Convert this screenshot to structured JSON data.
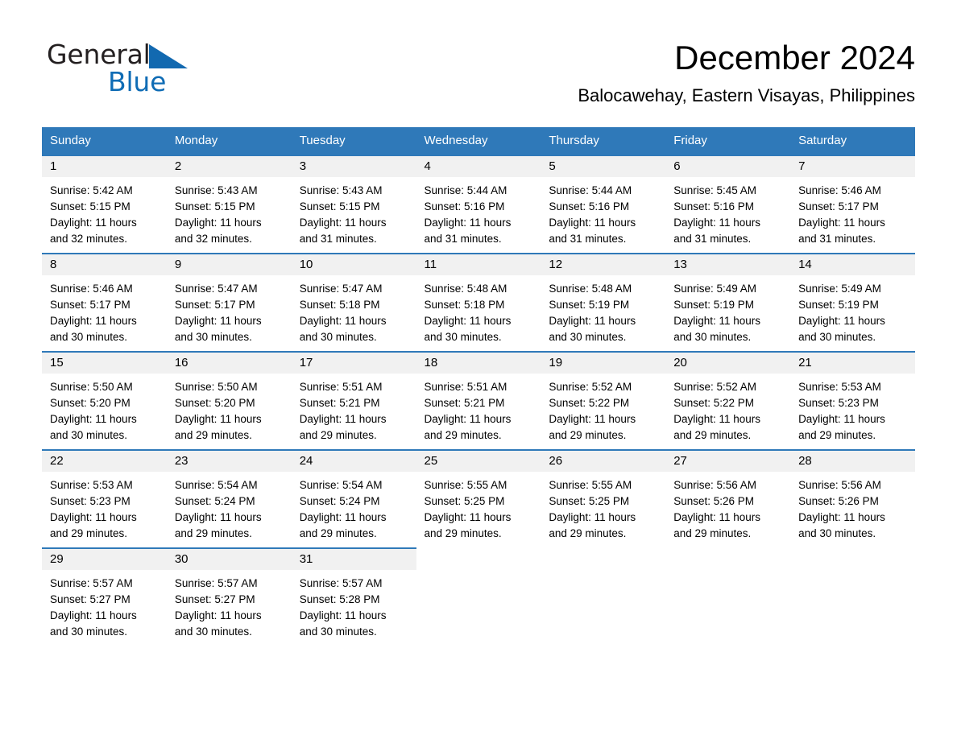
{
  "brand": {
    "name_part1": "General",
    "name_part2": "Blue",
    "triangle_color": "#1269b0",
    "text_color": "#231f20"
  },
  "header": {
    "title": "December 2024",
    "subtitle": "Balocawehay, Eastern Visayas, Philippines"
  },
  "colors": {
    "header_blue": "#2f79b9",
    "row_divider_blue": "#2f79b9",
    "daynum_band": "#f1f1f1",
    "background": "#ffffff",
    "text": "#000000"
  },
  "weekday_headers": [
    "Sunday",
    "Monday",
    "Tuesday",
    "Wednesday",
    "Thursday",
    "Friday",
    "Saturday"
  ],
  "labels": {
    "sunrise_prefix": "Sunrise:",
    "sunset_prefix": "Sunset:",
    "daylight_prefix": "Daylight:"
  },
  "weeks": [
    [
      {
        "day": "1",
        "sunrise": "Sunrise: 5:42 AM",
        "sunset": "Sunset: 5:15 PM",
        "daylight_line1": "Daylight: 11 hours",
        "daylight_line2": "and 32 minutes."
      },
      {
        "day": "2",
        "sunrise": "Sunrise: 5:43 AM",
        "sunset": "Sunset: 5:15 PM",
        "daylight_line1": "Daylight: 11 hours",
        "daylight_line2": "and 32 minutes."
      },
      {
        "day": "3",
        "sunrise": "Sunrise: 5:43 AM",
        "sunset": "Sunset: 5:15 PM",
        "daylight_line1": "Daylight: 11 hours",
        "daylight_line2": "and 31 minutes."
      },
      {
        "day": "4",
        "sunrise": "Sunrise: 5:44 AM",
        "sunset": "Sunset: 5:16 PM",
        "daylight_line1": "Daylight: 11 hours",
        "daylight_line2": "and 31 minutes."
      },
      {
        "day": "5",
        "sunrise": "Sunrise: 5:44 AM",
        "sunset": "Sunset: 5:16 PM",
        "daylight_line1": "Daylight: 11 hours",
        "daylight_line2": "and 31 minutes."
      },
      {
        "day": "6",
        "sunrise": "Sunrise: 5:45 AM",
        "sunset": "Sunset: 5:16 PM",
        "daylight_line1": "Daylight: 11 hours",
        "daylight_line2": "and 31 minutes."
      },
      {
        "day": "7",
        "sunrise": "Sunrise: 5:46 AM",
        "sunset": "Sunset: 5:17 PM",
        "daylight_line1": "Daylight: 11 hours",
        "daylight_line2": "and 31 minutes."
      }
    ],
    [
      {
        "day": "8",
        "sunrise": "Sunrise: 5:46 AM",
        "sunset": "Sunset: 5:17 PM",
        "daylight_line1": "Daylight: 11 hours",
        "daylight_line2": "and 30 minutes."
      },
      {
        "day": "9",
        "sunrise": "Sunrise: 5:47 AM",
        "sunset": "Sunset: 5:17 PM",
        "daylight_line1": "Daylight: 11 hours",
        "daylight_line2": "and 30 minutes."
      },
      {
        "day": "10",
        "sunrise": "Sunrise: 5:47 AM",
        "sunset": "Sunset: 5:18 PM",
        "daylight_line1": "Daylight: 11 hours",
        "daylight_line2": "and 30 minutes."
      },
      {
        "day": "11",
        "sunrise": "Sunrise: 5:48 AM",
        "sunset": "Sunset: 5:18 PM",
        "daylight_line1": "Daylight: 11 hours",
        "daylight_line2": "and 30 minutes."
      },
      {
        "day": "12",
        "sunrise": "Sunrise: 5:48 AM",
        "sunset": "Sunset: 5:19 PM",
        "daylight_line1": "Daylight: 11 hours",
        "daylight_line2": "and 30 minutes."
      },
      {
        "day": "13",
        "sunrise": "Sunrise: 5:49 AM",
        "sunset": "Sunset: 5:19 PM",
        "daylight_line1": "Daylight: 11 hours",
        "daylight_line2": "and 30 minutes."
      },
      {
        "day": "14",
        "sunrise": "Sunrise: 5:49 AM",
        "sunset": "Sunset: 5:19 PM",
        "daylight_line1": "Daylight: 11 hours",
        "daylight_line2": "and 30 minutes."
      }
    ],
    [
      {
        "day": "15",
        "sunrise": "Sunrise: 5:50 AM",
        "sunset": "Sunset: 5:20 PM",
        "daylight_line1": "Daylight: 11 hours",
        "daylight_line2": "and 30 minutes."
      },
      {
        "day": "16",
        "sunrise": "Sunrise: 5:50 AM",
        "sunset": "Sunset: 5:20 PM",
        "daylight_line1": "Daylight: 11 hours",
        "daylight_line2": "and 29 minutes."
      },
      {
        "day": "17",
        "sunrise": "Sunrise: 5:51 AM",
        "sunset": "Sunset: 5:21 PM",
        "daylight_line1": "Daylight: 11 hours",
        "daylight_line2": "and 29 minutes."
      },
      {
        "day": "18",
        "sunrise": "Sunrise: 5:51 AM",
        "sunset": "Sunset: 5:21 PM",
        "daylight_line1": "Daylight: 11 hours",
        "daylight_line2": "and 29 minutes."
      },
      {
        "day": "19",
        "sunrise": "Sunrise: 5:52 AM",
        "sunset": "Sunset: 5:22 PM",
        "daylight_line1": "Daylight: 11 hours",
        "daylight_line2": "and 29 minutes."
      },
      {
        "day": "20",
        "sunrise": "Sunrise: 5:52 AM",
        "sunset": "Sunset: 5:22 PM",
        "daylight_line1": "Daylight: 11 hours",
        "daylight_line2": "and 29 minutes."
      },
      {
        "day": "21",
        "sunrise": "Sunrise: 5:53 AM",
        "sunset": "Sunset: 5:23 PM",
        "daylight_line1": "Daylight: 11 hours",
        "daylight_line2": "and 29 minutes."
      }
    ],
    [
      {
        "day": "22",
        "sunrise": "Sunrise: 5:53 AM",
        "sunset": "Sunset: 5:23 PM",
        "daylight_line1": "Daylight: 11 hours",
        "daylight_line2": "and 29 minutes."
      },
      {
        "day": "23",
        "sunrise": "Sunrise: 5:54 AM",
        "sunset": "Sunset: 5:24 PM",
        "daylight_line1": "Daylight: 11 hours",
        "daylight_line2": "and 29 minutes."
      },
      {
        "day": "24",
        "sunrise": "Sunrise: 5:54 AM",
        "sunset": "Sunset: 5:24 PM",
        "daylight_line1": "Daylight: 11 hours",
        "daylight_line2": "and 29 minutes."
      },
      {
        "day": "25",
        "sunrise": "Sunrise: 5:55 AM",
        "sunset": "Sunset: 5:25 PM",
        "daylight_line1": "Daylight: 11 hours",
        "daylight_line2": "and 29 minutes."
      },
      {
        "day": "26",
        "sunrise": "Sunrise: 5:55 AM",
        "sunset": "Sunset: 5:25 PM",
        "daylight_line1": "Daylight: 11 hours",
        "daylight_line2": "and 29 minutes."
      },
      {
        "day": "27",
        "sunrise": "Sunrise: 5:56 AM",
        "sunset": "Sunset: 5:26 PM",
        "daylight_line1": "Daylight: 11 hours",
        "daylight_line2": "and 29 minutes."
      },
      {
        "day": "28",
        "sunrise": "Sunrise: 5:56 AM",
        "sunset": "Sunset: 5:26 PM",
        "daylight_line1": "Daylight: 11 hours",
        "daylight_line2": "and 30 minutes."
      }
    ],
    [
      {
        "day": "29",
        "sunrise": "Sunrise: 5:57 AM",
        "sunset": "Sunset: 5:27 PM",
        "daylight_line1": "Daylight: 11 hours",
        "daylight_line2": "and 30 minutes."
      },
      {
        "day": "30",
        "sunrise": "Sunrise: 5:57 AM",
        "sunset": "Sunset: 5:27 PM",
        "daylight_line1": "Daylight: 11 hours",
        "daylight_line2": "and 30 minutes."
      },
      {
        "day": "31",
        "sunrise": "Sunrise: 5:57 AM",
        "sunset": "Sunset: 5:28 PM",
        "daylight_line1": "Daylight: 11 hours",
        "daylight_line2": "and 30 minutes."
      },
      {
        "day": "",
        "sunrise": "",
        "sunset": "",
        "daylight_line1": "",
        "daylight_line2": "",
        "empty": true
      },
      {
        "day": "",
        "sunrise": "",
        "sunset": "",
        "daylight_line1": "",
        "daylight_line2": "",
        "empty": true
      },
      {
        "day": "",
        "sunrise": "",
        "sunset": "",
        "daylight_line1": "",
        "daylight_line2": "",
        "empty": true
      },
      {
        "day": "",
        "sunrise": "",
        "sunset": "",
        "daylight_line1": "",
        "daylight_line2": "",
        "empty": true
      }
    ]
  ]
}
